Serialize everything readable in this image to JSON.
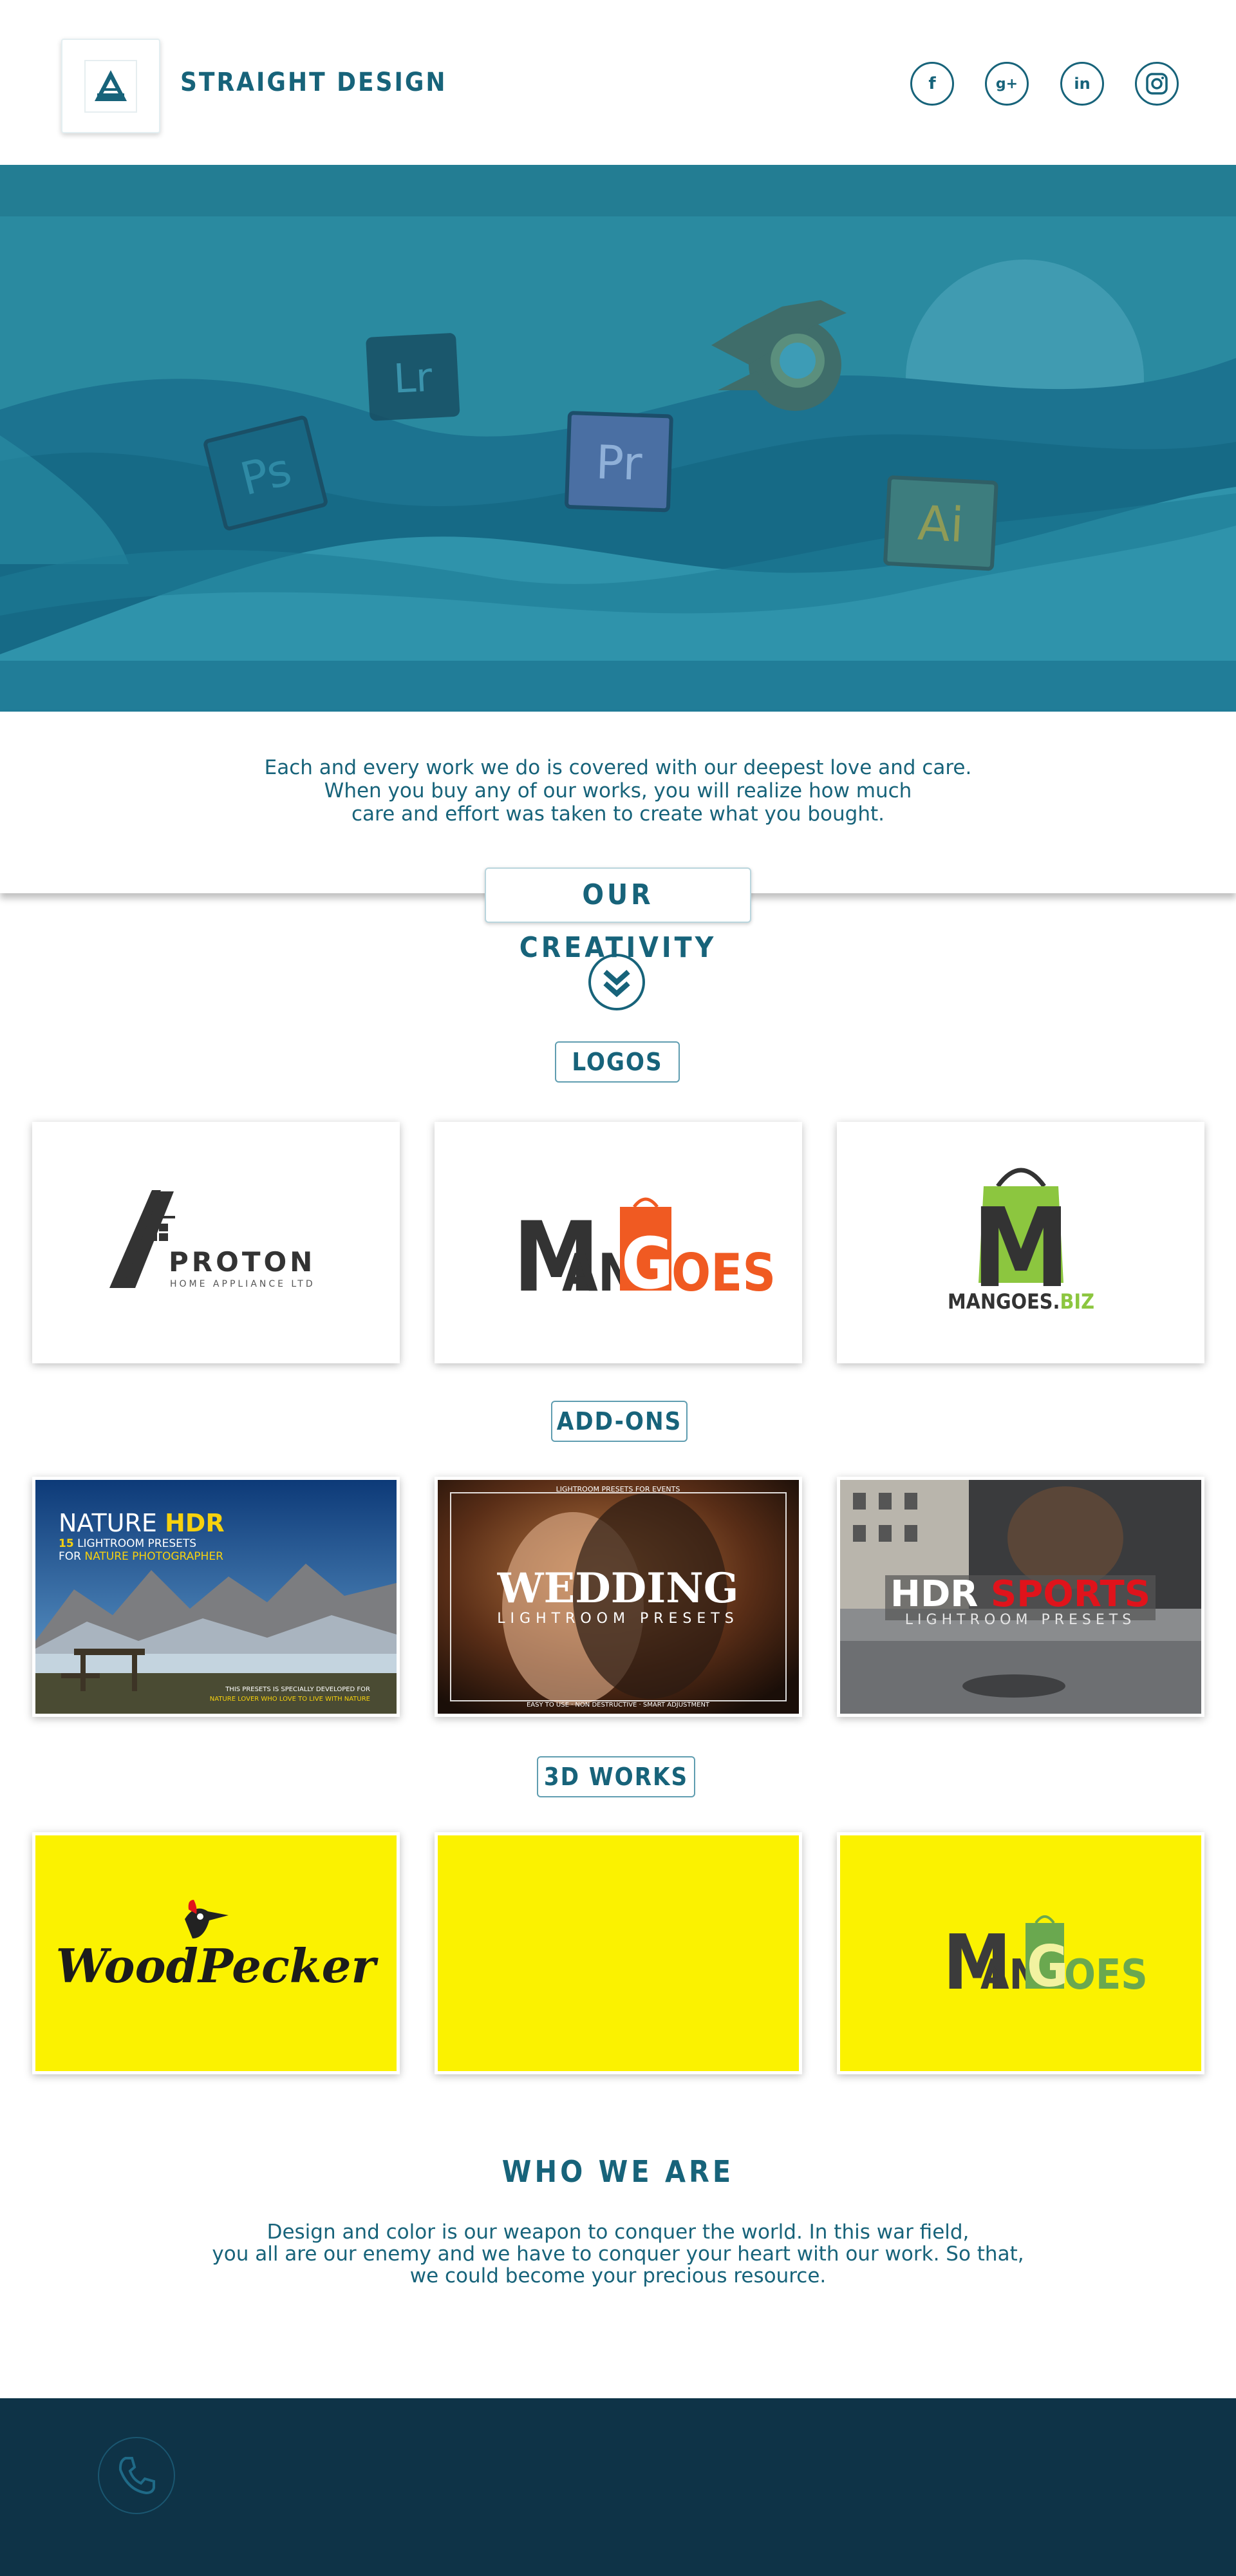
{
  "header": {
    "brand": "STRAIGHT DESIGN",
    "social": [
      {
        "name": "facebook",
        "glyph": "f"
      },
      {
        "name": "google-plus",
        "glyph": "g+"
      },
      {
        "name": "linkedin",
        "glyph": "in"
      },
      {
        "name": "instagram",
        "glyph": "◎"
      }
    ]
  },
  "hero": {
    "apps": [
      "Lr",
      "Ps",
      "Pr",
      "Ai"
    ]
  },
  "intro": {
    "line1": "Each and every work we do is covered with our deepest love and care.",
    "line2": "When you buy any of our works, you will realize how much",
    "line3": "care and effort was taken to create what you bought."
  },
  "creativity": {
    "title": "OUR CREATIVITY",
    "sections": {
      "logos": "LOGOS",
      "addons": "ADD-ONS",
      "works3d": "3D WORKS"
    }
  },
  "logos": {
    "proton": {
      "name": "PROTON",
      "tagline": "HOME APPLIANCE LTD"
    },
    "mangoes": {
      "part1": "M",
      "part2": "AN",
      "part3": "G",
      "part4": "OES"
    },
    "mangoesbiz": {
      "letter": "M",
      "name": "MANGOES.",
      "suffix": "BIZ"
    }
  },
  "addons": {
    "nature": {
      "title1": "NATURE ",
      "title2": "HDR",
      "sub1a": "15",
      "sub1b": " LIGHTROOM PRESETS",
      "sub2a": "FOR ",
      "sub2b": "NATURE PHOTOGRAPHER",
      "foot1": "THIS PRESETS IS SPECIALLY DEVELOPED FOR",
      "foot2": "NATURE LOVER WHO LOVE TO LIVE WITH NATURE"
    },
    "wedding": {
      "top": "LIGHTROOM PRESETS FOR EVENTS",
      "title": "WEDDING",
      "sub": "LIGHTROOM PRESETS",
      "foot": "EASY TO USE · NON DESTRUCTIVE · SMART ADJUSTMENT"
    },
    "sports": {
      "title1": "HDR ",
      "title2": "SPORTS",
      "sub": "LIGHTROOM PRESETS"
    }
  },
  "works3d": {
    "woodpecker": "WoodPecker",
    "mangoes": {
      "part1": "M",
      "part2": "AN",
      "part3": "G",
      "part4": "OES"
    }
  },
  "who": {
    "title": "WHO WE ARE",
    "line1": "Design and color is our weapon to conquer the world. In this war field,",
    "line2": "you all are our enemy and we have to conquer your heart with our work. So that,",
    "line3": "we could become your precious resource."
  },
  "colors": {
    "primary": "#17637a",
    "footer": "#0e3347",
    "hero": "#2a8aa0",
    "mangoes_orange": "#f05a22",
    "yellow": "#fbf200"
  }
}
